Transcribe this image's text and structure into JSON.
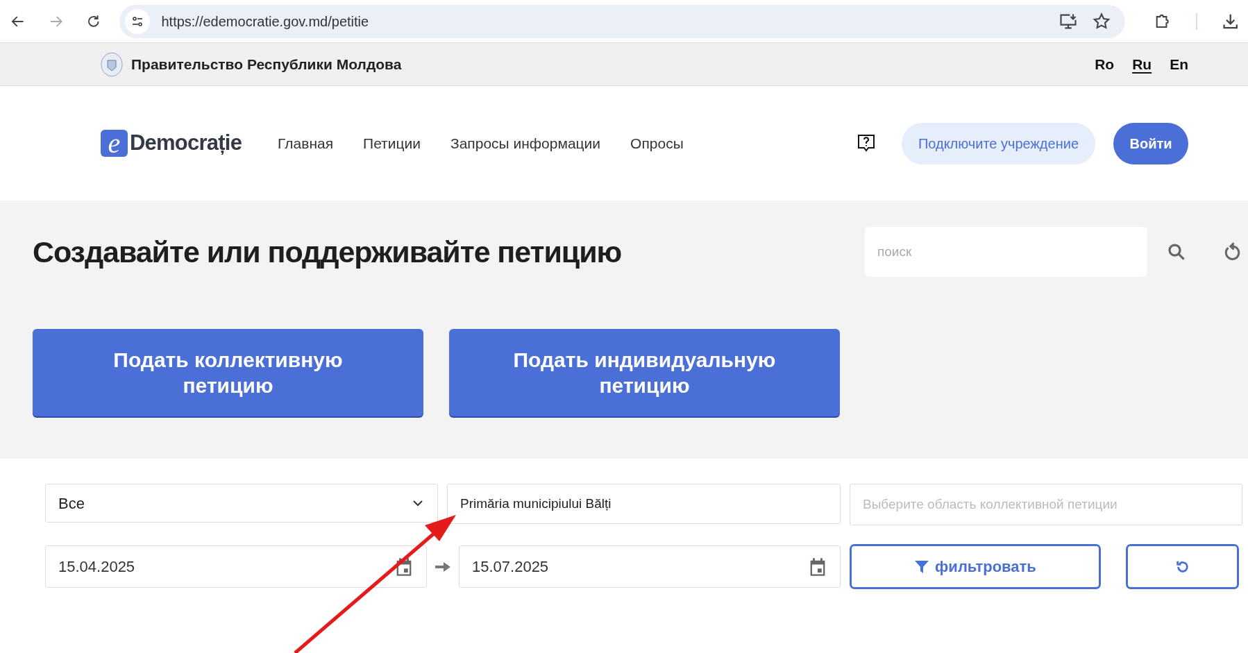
{
  "browser": {
    "url": "https://edemocratie.gov.md/petitie"
  },
  "gov_bar": {
    "title": "Правительство Республики Молдова",
    "languages": [
      {
        "label": "Ro",
        "selected": false
      },
      {
        "label": "Ru",
        "selected": true
      },
      {
        "label": "En",
        "selected": false
      }
    ]
  },
  "header": {
    "logo": {
      "letter": "e",
      "text": "Democrație"
    },
    "nav": [
      "Главная",
      "Петиции",
      "Запросы информации",
      "Опросы"
    ],
    "connect_button": "Подключите учреждение",
    "login_button": "Войти"
  },
  "hero": {
    "title": "Создавайте или поддерживайте петицию",
    "search": {
      "placeholder": "поиск"
    },
    "buttons": [
      "Подать коллективную петицию",
      "Подать индивидуальную петицию"
    ]
  },
  "filters": {
    "type_select": {
      "value": "Все"
    },
    "institution": {
      "value": "Primăria municipiului Bălți"
    },
    "area": {
      "placeholder": "Выберите область коллективной петиции"
    },
    "date_from": {
      "value": "15.04.2025"
    },
    "date_to": {
      "value": "15.07.2025"
    },
    "filter_button": "фильтровать"
  }
}
